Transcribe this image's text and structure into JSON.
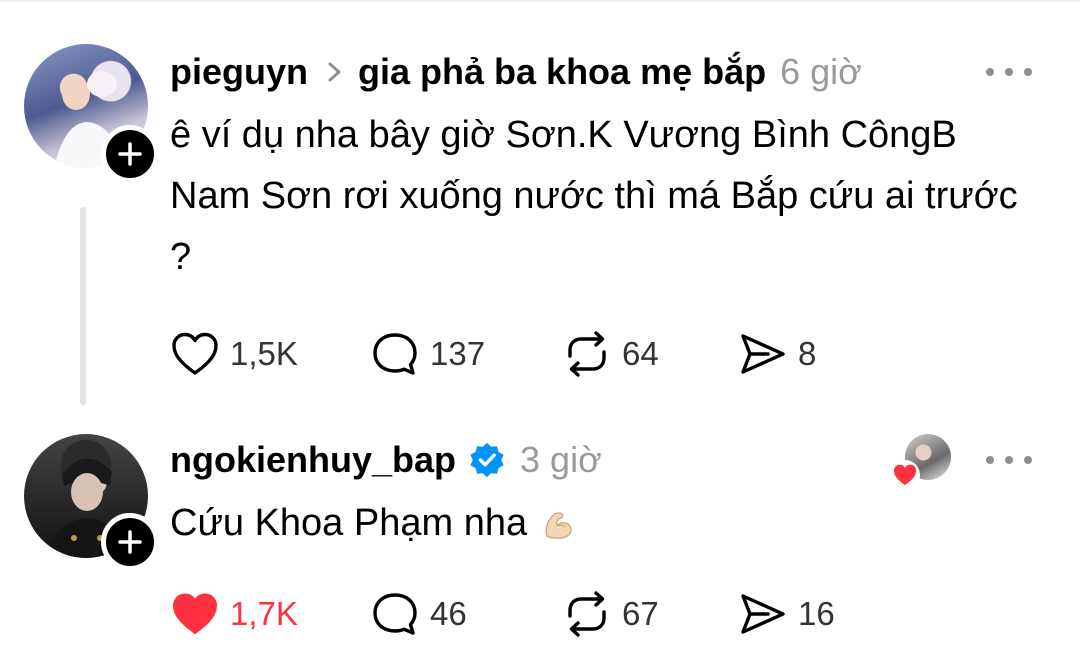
{
  "posts": [
    {
      "username": "pieguyn",
      "group": "gia phả ba khoa mẹ bắp",
      "time": "6 giờ",
      "text": "ê ví dụ nha bây giờ Sơn.K Vương Bình CôngB Nam Sơn rơi xuống nước thì má Bắp cứu ai trước ?",
      "likes": "1,5K",
      "replies": "137",
      "reposts": "64",
      "shares": "8",
      "liked": false
    },
    {
      "username": "ngokienhuy_bap",
      "verified": true,
      "time": "3 giờ",
      "text": "Cứu Khoa Phạm nha",
      "emoji": "flexed-biceps",
      "likes": "1,7K",
      "replies": "46",
      "reposts": "67",
      "shares": "16",
      "liked": true
    }
  ],
  "colors": {
    "like_active": "#ff3040",
    "verified": "#0095f6",
    "muted_text": "#9a9a9a",
    "thread_line": "#e3e3e3"
  },
  "icons": [
    "plus-icon",
    "chevron-right-icon",
    "more-icon",
    "heart-icon",
    "reply-icon",
    "repost-icon",
    "share-icon",
    "verified-badge-icon"
  ]
}
